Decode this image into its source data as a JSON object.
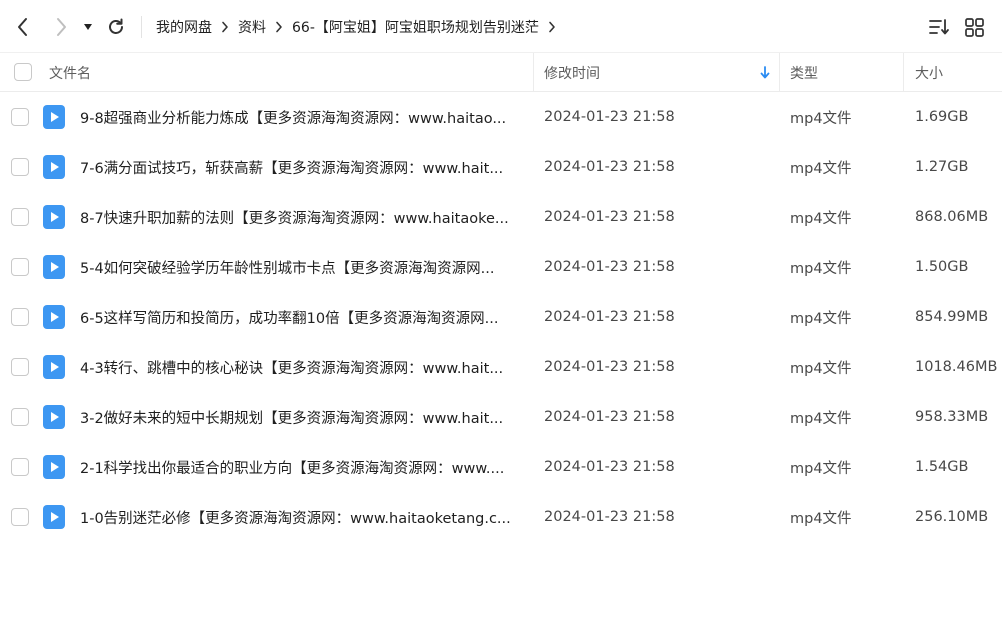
{
  "toolbar": {
    "back_icon": "chevron-left-icon",
    "forward_icon": "chevron-right-icon",
    "history_icon": "caret-down-icon",
    "refresh_icon": "refresh-icon",
    "sort_icon": "sort-list-icon",
    "grid_icon": "grid-view-icon"
  },
  "breadcrumb": {
    "items": [
      "我的网盘",
      "资料",
      "66-【阿宝姐】阿宝姐职场规划告别迷茫"
    ]
  },
  "table": {
    "headers": {
      "name": "文件名",
      "modified": "修改时间",
      "type": "类型",
      "size": "大小"
    },
    "sort_indicator": "arrow-down-icon",
    "rows": [
      {
        "name": "9-8超强商业分析能力炼成【更多资源海淘资源网：www.haitao...",
        "modified": "2024-01-23 21:58",
        "type": "mp4文件",
        "size": "1.69GB"
      },
      {
        "name": "7-6满分面试技巧，斩获高薪【更多资源海淘资源网：www.hait...",
        "modified": "2024-01-23 21:58",
        "type": "mp4文件",
        "size": "1.27GB"
      },
      {
        "name": "8-7快速升职加薪的法则【更多资源海淘资源网：www.haitaoke...",
        "modified": "2024-01-23 21:58",
        "type": "mp4文件",
        "size": "868.06MB"
      },
      {
        "name": "5-4如何突破经验学历年龄性别城市卡点【更多资源海淘资源网...",
        "modified": "2024-01-23 21:58",
        "type": "mp4文件",
        "size": "1.50GB"
      },
      {
        "name": "6-5这样写简历和投简历，成功率翻10倍【更多资源海淘资源网...",
        "modified": "2024-01-23 21:58",
        "type": "mp4文件",
        "size": "854.99MB"
      },
      {
        "name": "4-3转行、跳槽中的核心秘诀【更多资源海淘资源网：www.hait...",
        "modified": "2024-01-23 21:58",
        "type": "mp4文件",
        "size": "1018.46MB"
      },
      {
        "name": "3-2做好未来的短中长期规划【更多资源海淘资源网：www.hait...",
        "modified": "2024-01-23 21:58",
        "type": "mp4文件",
        "size": "958.33MB"
      },
      {
        "name": "2-1科学找出你最适合的职业方向【更多资源海淘资源网：www....",
        "modified": "2024-01-23 21:58",
        "type": "mp4文件",
        "size": "1.54GB"
      },
      {
        "name": "1-0告别迷茫必修【更多资源海淘资源网：www.haitaoketang.c...",
        "modified": "2024-01-23 21:58",
        "type": "mp4文件",
        "size": "256.10MB"
      }
    ]
  },
  "colors": {
    "accent": "#2b8cf2",
    "video_icon": "#3d97f2",
    "sort_arrow": "#2b8cf2",
    "icon_gray": "#333333",
    "icon_disabled": "#bfbfbf"
  }
}
